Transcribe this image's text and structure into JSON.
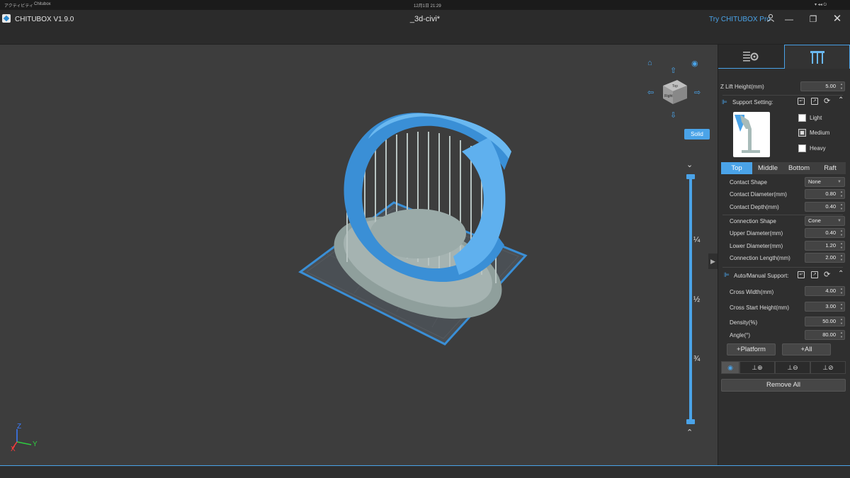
{
  "os_bar": {
    "left": "アクティビティ",
    "app": "Chitubox",
    "clock": "12月1日  21:29",
    "tray": "▾ ◂◂ ⏻"
  },
  "window": {
    "app_title": "CHITUBOX V1.9.0",
    "doc_title": "_3d-civi*",
    "try_pro": "Try CHITUBOX Pro"
  },
  "viewport": {
    "solid_label": "Solid",
    "slider_labels": [
      "¼",
      "½",
      "¾"
    ],
    "axis": {
      "z": "Z",
      "y": "Y",
      "x": "X"
    },
    "cube_faces": {
      "top": "Top",
      "front": "Right"
    }
  },
  "panel": {
    "z_lift_label": "Z Lift Height(mm)",
    "z_lift_value": "5.00",
    "support_setting_label": "Support Setting:",
    "presets": [
      {
        "label": "Light",
        "checked": false
      },
      {
        "label": "Medium",
        "checked": true
      },
      {
        "label": "Heavy",
        "checked": false
      }
    ],
    "tabs": [
      "Top",
      "Middle",
      "Bottom",
      "Raft"
    ],
    "active_tab": "Top",
    "top_params": [
      {
        "label": "Contact Shape",
        "value": "None",
        "kind": "dropdown"
      },
      {
        "label": "Contact Diameter(mm)",
        "value": "0.80",
        "kind": "spin"
      },
      {
        "label": "Contact Depth(mm)",
        "value": "0.40",
        "kind": "spin"
      },
      {
        "label": "Connection Shape",
        "value": "Cone",
        "kind": "dropdown"
      },
      {
        "label": "Upper Diameter(mm)",
        "value": "0.40",
        "kind": "spin"
      },
      {
        "label": "Lower Diameter(mm)",
        "value": "1.20",
        "kind": "spin"
      },
      {
        "label": "Connection Length(mm)",
        "value": "2.00",
        "kind": "spin"
      }
    ],
    "auto_manual_label": "Auto/Manual Support:",
    "auto_params": [
      {
        "label": "Cross Width(mm)",
        "value": "4.00"
      },
      {
        "label": "Cross Start Height(mm)",
        "value": "3.00"
      },
      {
        "label": "Density(%)",
        "value": "50.00"
      },
      {
        "label": "Angle(°)",
        "value": "80.00"
      }
    ],
    "platform_button": "+Platform",
    "all_button": "+All",
    "remove_all_button": "Remove All"
  },
  "colors": {
    "accent": "#4aa3e8",
    "model": "#3a8fd6",
    "support": "#9aaaa8"
  }
}
